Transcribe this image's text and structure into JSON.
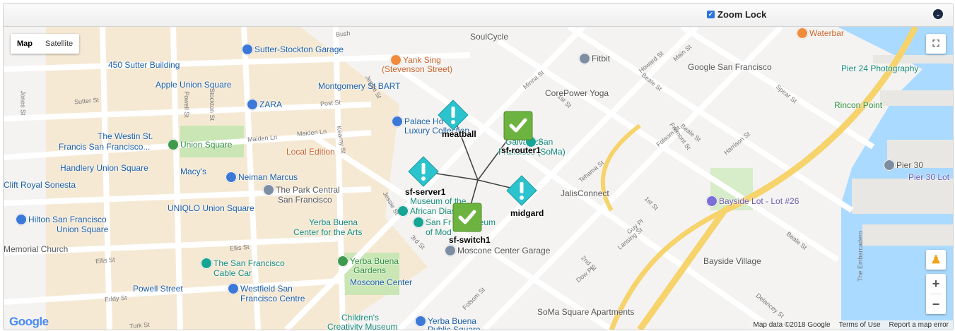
{
  "header": {
    "zoom_lock_label": "Zoom Lock",
    "zoom_lock_checked": true
  },
  "map_type": {
    "map": "Map",
    "satellite": "Satellite"
  },
  "map": {
    "places": [
      {
        "name": "Sutter-Stockton Garage",
        "cls": "poi-blue"
      },
      {
        "name": "450 Sutter Building",
        "cls": "poi-blue"
      },
      {
        "name": "Apple Union Square",
        "cls": "poi-blue"
      },
      {
        "name": "ZARA",
        "cls": "poi-blue"
      },
      {
        "name": "The Westin St.",
        "cls": "poi-blue"
      },
      {
        "name": "Francis San Francisco...",
        "cls": "poi-blue"
      },
      {
        "name": "Union Square",
        "cls": "poi-green"
      },
      {
        "name": "Handlery Union Square",
        "cls": "poi-blue"
      },
      {
        "name": "Macy's",
        "cls": "poi-blue"
      },
      {
        "name": "Neiman Marcus",
        "cls": "poi-blue"
      },
      {
        "name": "Clift Royal Sonesta",
        "cls": "poi-blue"
      },
      {
        "name": "UNIQLO Union Square",
        "cls": "poi-blue"
      },
      {
        "name": "Hilton San Francisco",
        "cls": "poi-blue"
      },
      {
        "name": "Union Square",
        "cls": "poi-blue"
      },
      {
        "name": "Memorial Church",
        "cls": "poi-gray"
      },
      {
        "name": "The San Francisco",
        "cls": "poi-teal"
      },
      {
        "name": "Cable Car",
        "cls": "poi-teal"
      },
      {
        "name": "Powell Street",
        "cls": "poi-blue"
      },
      {
        "name": "Westfield San",
        "cls": "poi-blue"
      },
      {
        "name": "Francisco Centre",
        "cls": "poi-blue"
      },
      {
        "name": "SoulCycle",
        "cls": "poi-gray"
      },
      {
        "name": "Yank Sing",
        "cls": "poi-orange"
      },
      {
        "name": "(Stevenson Street)",
        "cls": "poi-orange"
      },
      {
        "name": "Montgomery St BART",
        "cls": "poi-blue"
      },
      {
        "name": "Palace Ho",
        "cls": "poi-blue"
      },
      {
        "name": "Luxury Collection",
        "cls": "poi-blue"
      },
      {
        "name": "Local Edition",
        "cls": "poi-orange"
      },
      {
        "name": "The Park Central",
        "cls": "poi-gray"
      },
      {
        "name": "San Francisco",
        "cls": "poi-gray"
      },
      {
        "name": "Museum of the",
        "cls": "poi-teal"
      },
      {
        "name": "African Diaspora",
        "cls": "poi-teal"
      },
      {
        "name": "Yerba Buena",
        "cls": "poi-teal"
      },
      {
        "name": "Center for the Arts",
        "cls": "poi-teal"
      },
      {
        "name": "San Fr",
        "cls": "poi-teal"
      },
      {
        "name": "of Mod",
        "cls": "poi-teal"
      },
      {
        "name": "Museum",
        "cls": "poi-teal"
      },
      {
        "name": "Yerba Buena",
        "cls": "poi-green"
      },
      {
        "name": "Gardens",
        "cls": "poi-green"
      },
      {
        "name": "Moscone Center",
        "cls": "poi-blue"
      },
      {
        "name": "Moscone Center Garage",
        "cls": "poi-gray"
      },
      {
        "name": "Children's",
        "cls": "poi-teal"
      },
      {
        "name": "Creativity Museum",
        "cls": "poi-teal"
      },
      {
        "name": "Yerba Buena",
        "cls": "poi-blue"
      },
      {
        "name": "Public Square",
        "cls": "poi-blue"
      },
      {
        "name": "Galvanize",
        "cls": "poi-teal"
      },
      {
        "name": "San",
        "cls": "poi-teal"
      },
      {
        "name": "Francisco (SoMa)",
        "cls": "poi-teal"
      },
      {
        "name": "CorePower Yoga",
        "cls": "poi-gray"
      },
      {
        "name": "Fitbit",
        "cls": "poi-gray"
      },
      {
        "name": "Google San Francisco",
        "cls": "poi-gray"
      },
      {
        "name": "JalisConnect",
        "cls": "poi-gray"
      },
      {
        "name": "Bayside Lot - Lot #26",
        "cls": "poi-violet"
      },
      {
        "name": "Bayside Village",
        "cls": "poi-gray"
      },
      {
        "name": "SoMa Square Apartments",
        "cls": "poi-gray"
      },
      {
        "name": "Waterbar",
        "cls": "poi-orange"
      },
      {
        "name": "Pier 24 Photography",
        "cls": "poi-teal"
      },
      {
        "name": "Rincon Point",
        "cls": "poi-green"
      },
      {
        "name": "Pier 30",
        "cls": "poi-gray"
      },
      {
        "name": "Pier 30 Lot",
        "cls": "poi-violet"
      }
    ],
    "streets": [
      "Sutter St",
      "Maiden Ln",
      "Maiden Ln",
      "Post St",
      "Kearny St",
      "Jessie St",
      "Jessie St",
      "Ellis St",
      "Ellis St",
      "Eddy St",
      "3rd St",
      "2nd St",
      "1st St",
      "1st St",
      "Folsom St",
      "Folsom St",
      "Fremont St",
      "Harrison St",
      "Howard St",
      "Main St",
      "Beale St",
      "Beale St",
      "Spear St",
      "Tehama St",
      "Minna St",
      "Guy Pl",
      "Lansing St",
      "Dow Pl",
      "Delancey St",
      "Beale St",
      "The Embarcadero",
      "Stockton St",
      "Powell St",
      "Jones St",
      "Turk St",
      "Bush"
    ],
    "devices": [
      {
        "name": "meatball",
        "status": "warning"
      },
      {
        "name": "sf-router1",
        "status": "ok"
      },
      {
        "name": "sf-server1",
        "status": "warning"
      },
      {
        "name": "midgard",
        "status": "warning"
      },
      {
        "name": "sf-switch1",
        "status": "ok"
      }
    ]
  },
  "controls": {
    "zoom_in": "+",
    "zoom_out": "−"
  },
  "branding": {
    "logo": "Google"
  },
  "footer": {
    "map_data": "Map data ©2018 Google",
    "terms": "Terms of Use",
    "report": "Report a map error"
  },
  "colors": {
    "ok": "#6db33f",
    "warning": "#2bc3cd",
    "highway": "#f6d36b"
  }
}
